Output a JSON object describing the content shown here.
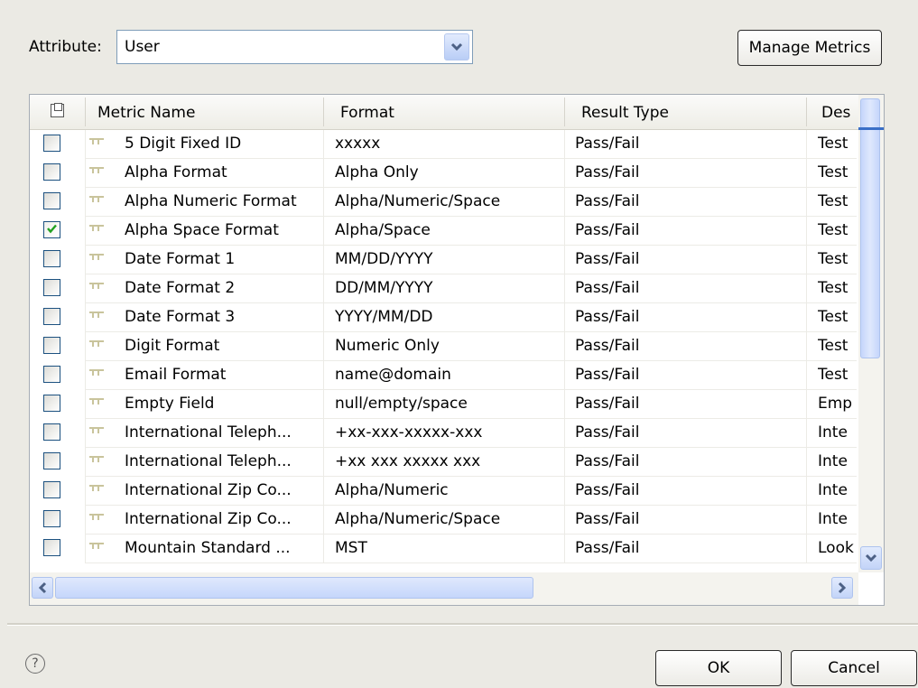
{
  "attribute": {
    "label": "Attribute:",
    "value": "User"
  },
  "toolbar": {
    "manage_metrics_label": "Manage Metrics"
  },
  "table": {
    "columns": [
      "Metric Name",
      "Format",
      "Result Type",
      "Des"
    ],
    "rows": [
      {
        "checked": false,
        "name": "5 Digit Fixed ID",
        "format": "xxxxx",
        "result": "Pass/Fail",
        "desc": "Test"
      },
      {
        "checked": false,
        "name": "Alpha Format",
        "format": "Alpha Only",
        "result": "Pass/Fail",
        "desc": "Test"
      },
      {
        "checked": false,
        "name": "Alpha Numeric Format",
        "format": "Alpha/Numeric/Space",
        "result": "Pass/Fail",
        "desc": "Test"
      },
      {
        "checked": true,
        "name": "Alpha Space Format",
        "format": "Alpha/Space",
        "result": "Pass/Fail",
        "desc": "Test"
      },
      {
        "checked": false,
        "name": "Date Format 1",
        "format": "MM/DD/YYYY",
        "result": "Pass/Fail",
        "desc": "Test"
      },
      {
        "checked": false,
        "name": "Date Format 2",
        "format": "DD/MM/YYYY",
        "result": "Pass/Fail",
        "desc": "Test"
      },
      {
        "checked": false,
        "name": "Date Format 3",
        "format": "YYYY/MM/DD",
        "result": "Pass/Fail",
        "desc": "Test"
      },
      {
        "checked": false,
        "name": "Digit Format",
        "format": "Numeric Only",
        "result": "Pass/Fail",
        "desc": "Test"
      },
      {
        "checked": false,
        "name": "Email Format",
        "format": "name@domain",
        "result": "Pass/Fail",
        "desc": "Test"
      },
      {
        "checked": false,
        "name": "Empty Field",
        "format": "null/empty/space",
        "result": "Pass/Fail",
        "desc": "Emp"
      },
      {
        "checked": false,
        "name": "International Teleph...",
        "format": "+xx-xxx-xxxxx-xxx",
        "result": "Pass/Fail",
        "desc": "Inte"
      },
      {
        "checked": false,
        "name": "International Teleph...",
        "format": "+xx xxx xxxxx xxx",
        "result": "Pass/Fail",
        "desc": "Inte"
      },
      {
        "checked": false,
        "name": "International Zip Co...",
        "format": "Alpha/Numeric",
        "result": "Pass/Fail",
        "desc": "Inte"
      },
      {
        "checked": false,
        "name": "International Zip Co...",
        "format": "Alpha/Numeric/Space",
        "result": "Pass/Fail",
        "desc": "Inte"
      },
      {
        "checked": false,
        "name": "Mountain Standard ...",
        "format": "MST",
        "result": "Pass/Fail",
        "desc": "Look"
      }
    ]
  },
  "footer": {
    "help_glyph": "?",
    "ok_label": "OK",
    "cancel_label": "Cancel"
  },
  "colors": {
    "accent": "#3a6fc7",
    "check": "#21a121",
    "scroll_thumb": "#c5d6fb"
  },
  "icons": [
    "chevron-down-icon",
    "metric-row-icon",
    "checkmark-icon",
    "help-icon",
    "arrow-left-icon",
    "arrow-right-icon"
  ]
}
